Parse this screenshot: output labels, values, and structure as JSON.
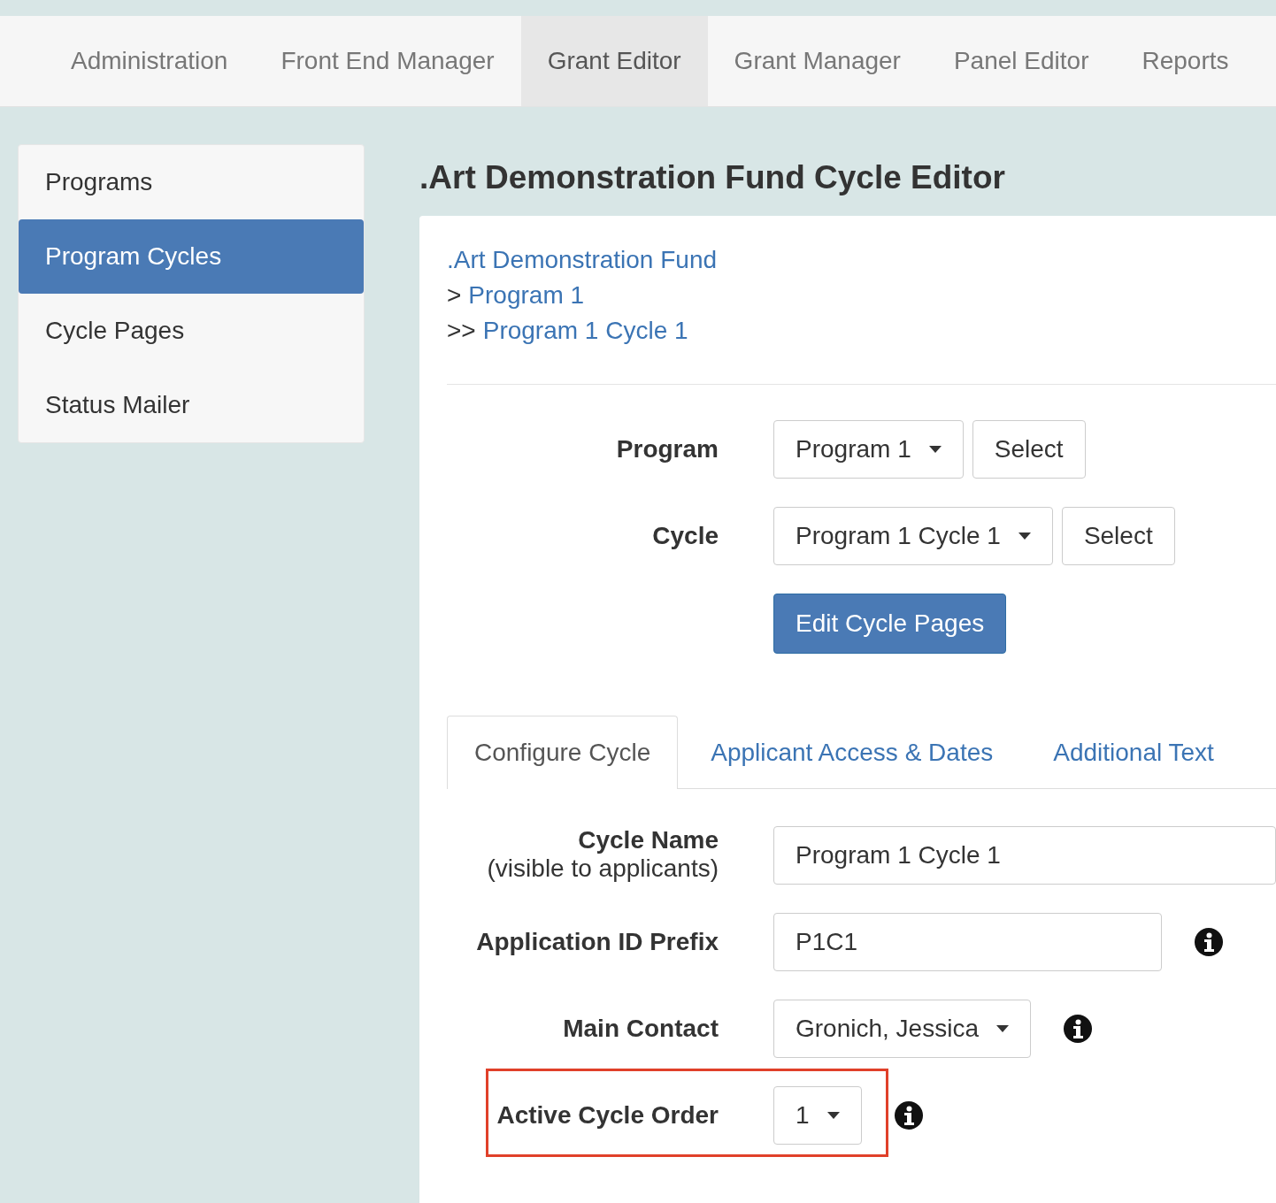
{
  "top_nav": [
    {
      "label": "Administration",
      "selected": false
    },
    {
      "label": "Front End Manager",
      "selected": false
    },
    {
      "label": "Grant Editor",
      "selected": true
    },
    {
      "label": "Grant Manager",
      "selected": false
    },
    {
      "label": "Panel Editor",
      "selected": false
    },
    {
      "label": "Reports",
      "selected": false
    }
  ],
  "sidebar": {
    "items": [
      {
        "label": "Programs",
        "selected": false
      },
      {
        "label": "Program Cycles",
        "selected": true
      },
      {
        "label": "Cycle Pages",
        "selected": false
      },
      {
        "label": "Status Mailer",
        "selected": false
      }
    ]
  },
  "page_title": ".Art Demonstration Fund Cycle Editor",
  "breadcrumb": [
    {
      "link": ".Art Demonstration Fund"
    },
    {
      "prefix": ">",
      "link": "Program 1"
    },
    {
      "prefix": ">>",
      "link": "Program 1 Cycle 1"
    }
  ],
  "selectors": [
    {
      "label": "Program",
      "value": "Program 1",
      "button": "Select"
    },
    {
      "label": "Cycle",
      "value": "Program 1 Cycle 1",
      "button": "Select"
    }
  ],
  "edit_button": "Edit Cycle Pages",
  "tabs": [
    {
      "label": "Configure Cycle",
      "selected": true
    },
    {
      "label": "Applicant Access & Dates",
      "selected": false
    },
    {
      "label": "Additional Text",
      "selected": false
    }
  ],
  "fields": [
    {
      "kind": "text",
      "label": "Cycle Name",
      "sublabel": "(visible to applicants)",
      "value": "Program 1 Cycle 1",
      "info": false,
      "highlighted": false
    },
    {
      "kind": "text",
      "label": "Application ID Prefix",
      "value": "P1C1",
      "info": true,
      "highlighted": false
    },
    {
      "kind": "dropdown",
      "label": "Main Contact",
      "value": "Gronich, Jessica",
      "info": true,
      "highlighted": false
    },
    {
      "kind": "dropdown",
      "label": "Active Cycle Order",
      "value": "1",
      "info": true,
      "highlighted": true
    }
  ]
}
